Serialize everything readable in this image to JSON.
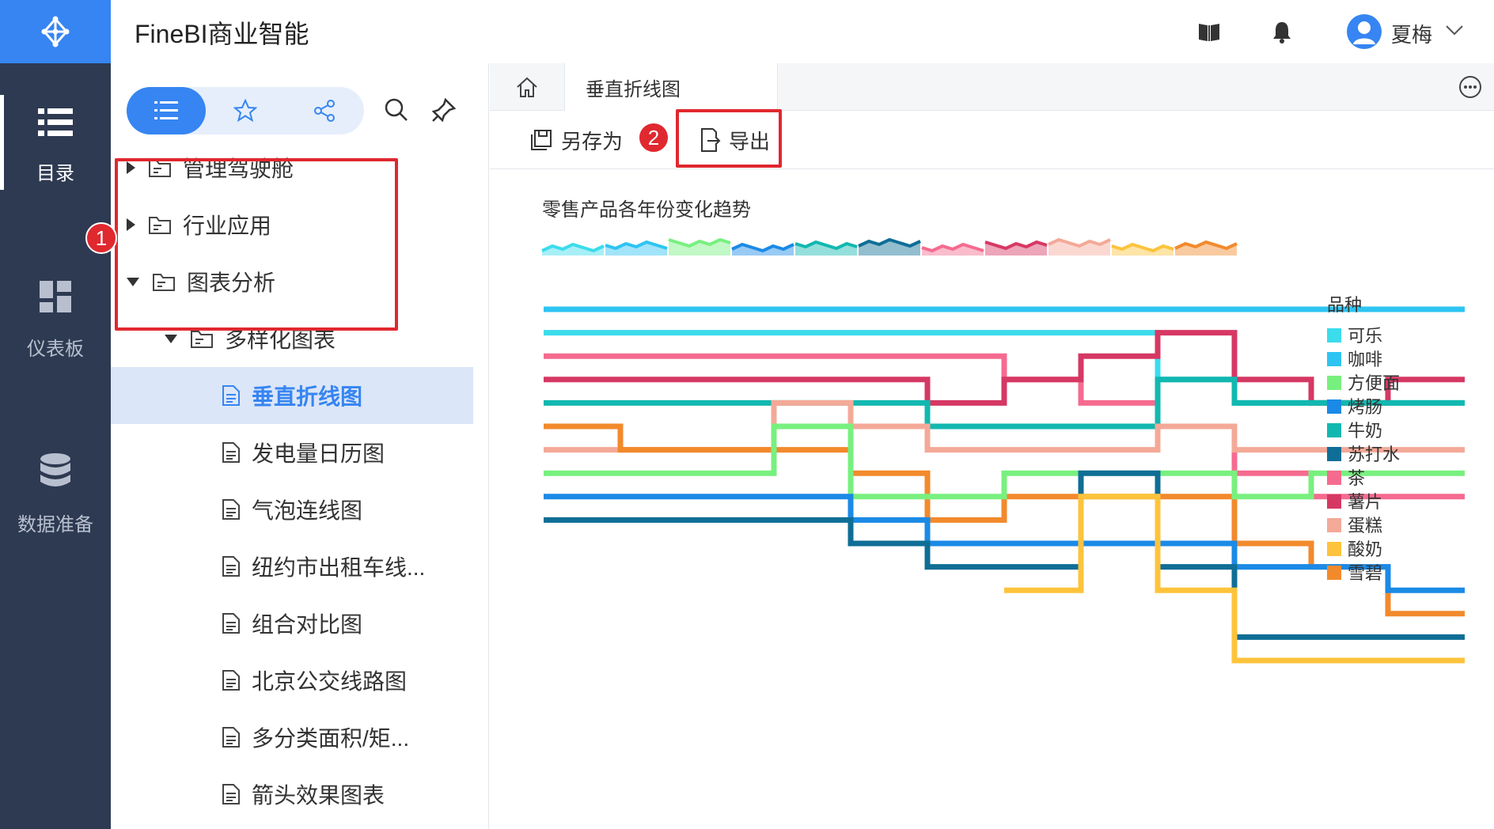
{
  "app": {
    "title": "FineBI商业智能"
  },
  "header": {
    "user_name": "夏梅",
    "icons": [
      "book-icon",
      "bell-icon",
      "user-icon",
      "chevron-down-icon"
    ]
  },
  "leftnav": {
    "items": [
      {
        "label": "目录",
        "icon": "list-icon",
        "active": true
      },
      {
        "label": "仪表板",
        "icon": "dashboard-icon",
        "active": false
      },
      {
        "label": "数据准备",
        "icon": "database-icon",
        "active": false
      }
    ]
  },
  "dirpanel": {
    "tabs": [
      {
        "icon": "list-icon",
        "active": true
      },
      {
        "icon": "star-icon",
        "active": false
      },
      {
        "icon": "share-icon",
        "active": false
      }
    ],
    "tools": [
      "search-icon",
      "pin-icon"
    ],
    "tree": [
      {
        "label": "管理驾驶舱",
        "type": "folder",
        "arrow": "right",
        "level": 0
      },
      {
        "label": "行业应用",
        "type": "folder",
        "arrow": "right",
        "level": 0
      },
      {
        "label": "图表分析",
        "type": "folder",
        "arrow": "down",
        "level": 0
      },
      {
        "label": "多样化图表",
        "type": "folder",
        "arrow": "down",
        "level": 1
      },
      {
        "label": "垂直折线图",
        "type": "doc",
        "level": 2,
        "selected": true
      },
      {
        "label": "发电量日历图",
        "type": "doc",
        "level": 2
      },
      {
        "label": "气泡连线图",
        "type": "doc",
        "level": 2
      },
      {
        "label": "纽约市出租车线...",
        "type": "doc",
        "level": 2
      },
      {
        "label": "组合对比图",
        "type": "doc",
        "level": 2
      },
      {
        "label": "北京公交线路图",
        "type": "doc",
        "level": 2
      },
      {
        "label": "多分类面积/矩...",
        "type": "doc",
        "level": 2
      },
      {
        "label": "箭头效果图表",
        "type": "doc",
        "level": 2
      }
    ]
  },
  "callouts": [
    {
      "number": "1"
    },
    {
      "number": "2"
    }
  ],
  "main": {
    "home_icon": "home-icon",
    "tab_label": "垂直折线图",
    "more_icon": "more-icon",
    "toolbar": {
      "save_as_label": "另存为",
      "export_label": "导出"
    }
  },
  "colors": {
    "accent": "#3685f2",
    "nav_bg": "#2e3a52",
    "callout": "#e0282f"
  },
  "chart_data": {
    "type": "line",
    "title": "零售产品各年份变化趋势",
    "legend_title": "品种",
    "legend_position": "right",
    "series": [
      {
        "name": "可乐",
        "color": "#3bdcec"
      },
      {
        "name": "咖啡",
        "color": "#2ec4f2"
      },
      {
        "name": "方便面",
        "color": "#78f07f"
      },
      {
        "name": "烤肠",
        "color": "#1b8ae6"
      },
      {
        "name": "牛奶",
        "color": "#12b8b0"
      },
      {
        "name": "苏打水",
        "color": "#0f6e96"
      },
      {
        "name": "茶",
        "color": "#f56b8f"
      },
      {
        "name": "薯片",
        "color": "#d63864"
      },
      {
        "name": "蛋糕",
        "color": "#f4a998"
      },
      {
        "name": "酸奶",
        "color": "#fdc33c"
      },
      {
        "name": "雪碧",
        "color": "#f28a2c"
      }
    ]
  }
}
